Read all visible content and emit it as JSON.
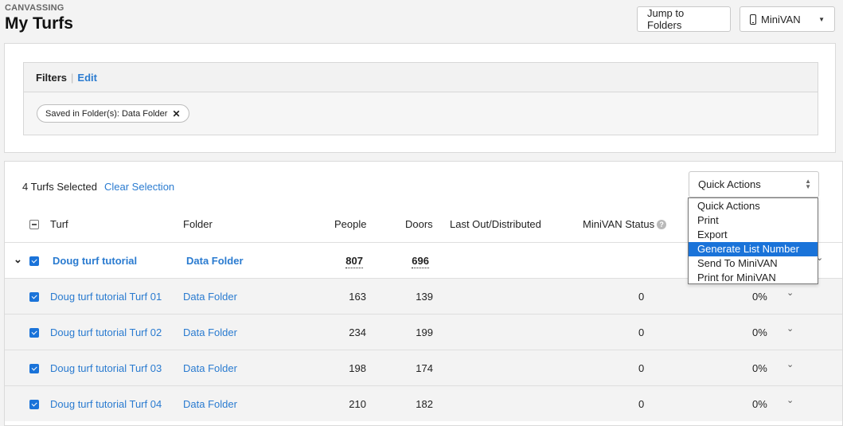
{
  "header": {
    "eyebrow": "CANVASSING",
    "title": "My Turfs",
    "jump_button": "Jump to Folders",
    "minivan_button": "MiniVAN"
  },
  "filters": {
    "label": "Filters",
    "edit": "Edit",
    "chip": "Saved in Folder(s): Data Folder"
  },
  "selection": {
    "count_text": "4 Turfs Selected",
    "clear_text": "Clear Selection"
  },
  "quick_actions": {
    "selected": "Quick Actions",
    "options": [
      "Quick Actions",
      "Print",
      "Export",
      "Generate List Number",
      "Send To MiniVAN",
      "Print for MiniVAN"
    ],
    "highlighted": "Generate List Number"
  },
  "columns": {
    "turf": "Turf",
    "folder": "Folder",
    "people": "People",
    "doors": "Doors",
    "last_out": "Last Out/Distributed",
    "minivan_status": "MiniVAN Status"
  },
  "parent_row": {
    "turf": "Doug turf tutorial",
    "folder": "Data Folder",
    "people": "807",
    "doors": "696"
  },
  "rows": [
    {
      "turf": "Doug turf tutorial Turf 01",
      "folder": "Data Folder",
      "people": "163",
      "doors": "139",
      "minivan": "0",
      "pct": "0%"
    },
    {
      "turf": "Doug turf tutorial Turf 02",
      "folder": "Data Folder",
      "people": "234",
      "doors": "199",
      "minivan": "0",
      "pct": "0%"
    },
    {
      "turf": "Doug turf tutorial Turf 03",
      "folder": "Data Folder",
      "people": "198",
      "doors": "174",
      "minivan": "0",
      "pct": "0%"
    },
    {
      "turf": "Doug turf tutorial Turf 04",
      "folder": "Data Folder",
      "people": "210",
      "doors": "182",
      "minivan": "0",
      "pct": "0%"
    }
  ]
}
